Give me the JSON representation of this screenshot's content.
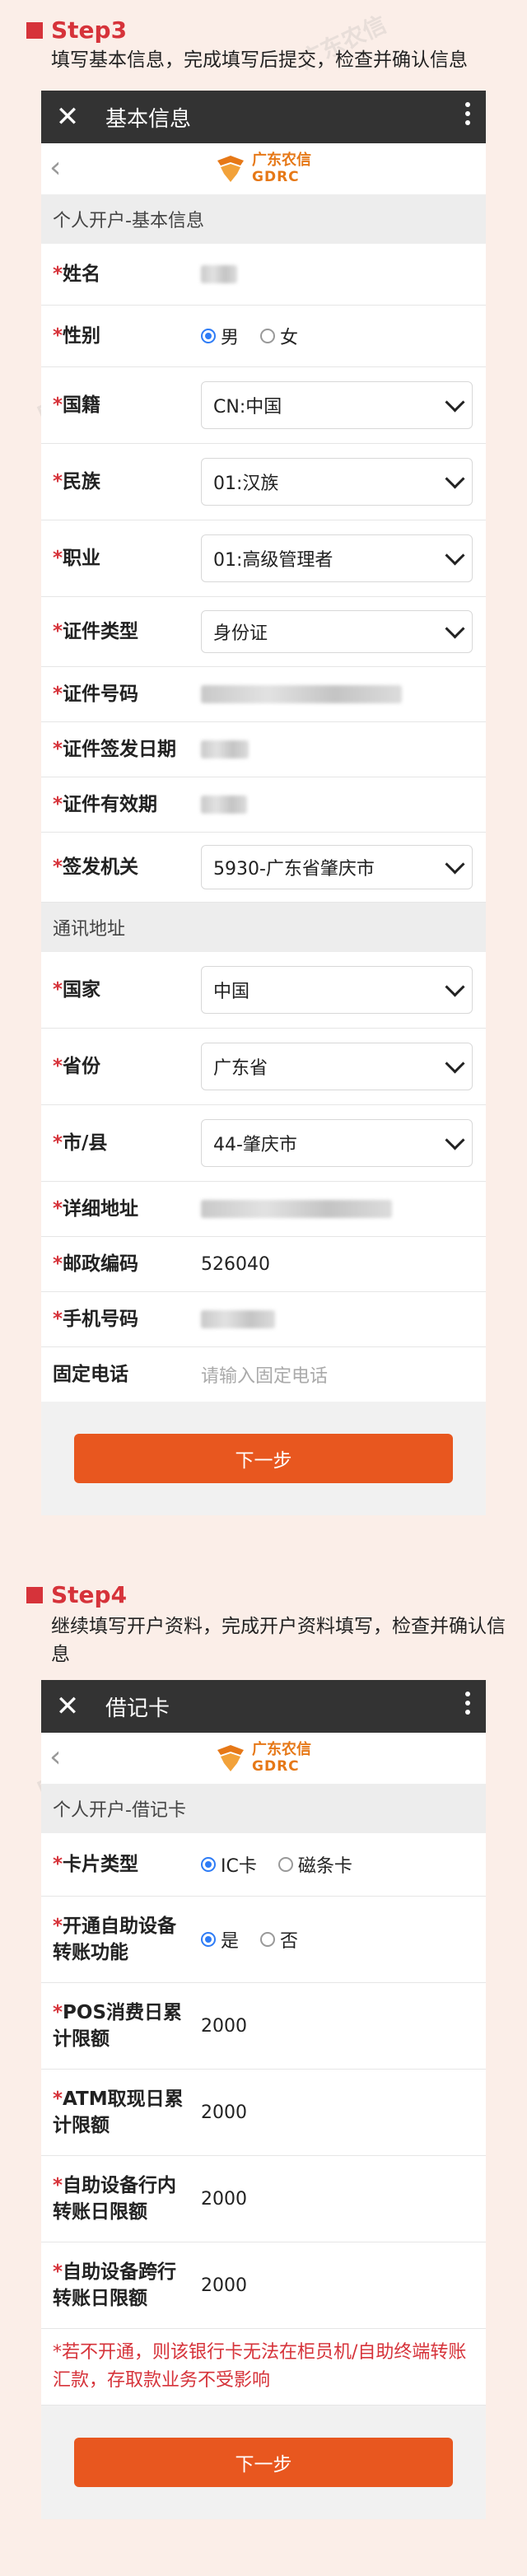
{
  "step3": {
    "title": "Step3",
    "description": "填写基本信息，完成填写后提交，检查并确认信息"
  },
  "step3_screen": {
    "topbar_title": "基本信息",
    "logo_cn": "广东农信",
    "logo_en": "GDRC",
    "section_personal": "个人开户-基本信息",
    "fields": {
      "name": {
        "label": "姓名"
      },
      "gender": {
        "label": "性别",
        "options": [
          "男",
          "女"
        ],
        "selected": "男"
      },
      "nationality": {
        "label": "国籍",
        "value": "CN:中国"
      },
      "ethnicity": {
        "label": "民族",
        "value": "01:汉族"
      },
      "occupation": {
        "label": "职业",
        "value": "01:高级管理者"
      },
      "id_type": {
        "label": "证件类型",
        "value": "身份证"
      },
      "id_number": {
        "label": "证件号码"
      },
      "id_issue_date": {
        "label": "证件签发日期"
      },
      "id_expiry": {
        "label": "证件有效期"
      },
      "issuing_authority": {
        "label": "签发机关",
        "value": "5930-广东省肇庆市"
      }
    },
    "section_address": "通讯地址",
    "address": {
      "country": {
        "label": "国家",
        "value": "中国"
      },
      "province": {
        "label": "省份",
        "value": "广东省"
      },
      "city": {
        "label": "市/县",
        "value": "44-肇庆市"
      },
      "detail": {
        "label": "详细地址"
      },
      "postcode": {
        "label": "邮政编码",
        "value": "526040"
      },
      "mobile": {
        "label": "手机号码"
      },
      "landline": {
        "label": "固定电话",
        "placeholder": "请输入固定电话"
      }
    },
    "next_button": "下一步"
  },
  "step4": {
    "title": "Step4",
    "description": "继续填写开户资料，完成开户资料填写，检查并确认信息"
  },
  "step4_screen": {
    "topbar_title": "借记卡",
    "logo_cn": "广东农信",
    "logo_en": "GDRC",
    "section_title": "个人开户-借记卡",
    "card_type": {
      "label": "卡片类型",
      "options": [
        "IC卡",
        "磁条卡"
      ],
      "selected": "IC卡"
    },
    "self_service": {
      "label": "开通自助设备转账功能",
      "options": [
        "是",
        "否"
      ],
      "selected": "是"
    },
    "pos_limit": {
      "label": "POS消费日累计限额",
      "value": "2000"
    },
    "atm_limit": {
      "label": "ATM取现日累计限额",
      "value": "2000"
    },
    "intra_limit": {
      "label": "自助设备行内转账日限额",
      "value": "2000"
    },
    "inter_limit": {
      "label": "自助设备跨行转账日限额",
      "value": "2000"
    },
    "notice": "*若不开通，则该银行卡无法在柜员机/自助终端转账汇款，存取款业务不受影响",
    "next_button": "下一步"
  },
  "colors": {
    "accent_red": "#d6333a",
    "button_orange": "#e8571f",
    "logo_orange": "#e67817",
    "radio_blue": "#2e7cf6",
    "topbar": "#333333"
  },
  "icons": [
    "close-icon",
    "more-icon",
    "back-icon",
    "chevron-down-icon",
    "gdrc-logo-icon"
  ]
}
